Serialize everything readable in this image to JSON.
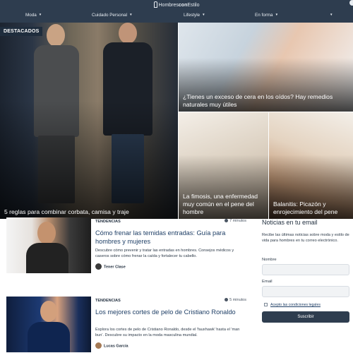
{
  "header": {
    "logo_part1": "Hombres",
    "logo_part2": "con",
    "logo_part3": "Estilo",
    "nav": [
      {
        "label": "Moda"
      },
      {
        "label": "Cuidado Personal"
      },
      {
        "label": "Lifestyle"
      },
      {
        "label": "En forma"
      },
      {
        "label": ""
      }
    ],
    "caret_icon": "caret-down-icon"
  },
  "hero": {
    "badge": "DESTACADOS",
    "tiles": [
      {
        "title": "5 reglas para combinar corbata, camisa y traje"
      },
      {
        "title": "¿Tienes un exceso de cera en los oídos? Hay remedios naturales muy útiles"
      },
      {
        "title": "La fimosis, una enfermedad muy común en el pene del hombre"
      },
      {
        "title": "Balanitis: Picazón y enrojecimiento del pene"
      }
    ]
  },
  "articles": [
    {
      "category": "TENDENCIAS",
      "read_time": "7 minutos",
      "title": "Cómo frenar las temidas entradas: Guía para hombres y mujeres",
      "description": "Descubre cómo prevenir y tratar las entradas en hombres. Consejos médicos y caseros sobre cómo frenar la caída y fortalecer tu cabello.",
      "author": "Tener Clase"
    },
    {
      "category": "TENDENCIAS",
      "read_time": "5 minutos",
      "title": "Los mejores cortes de pelo de Cristiano Ronaldo",
      "description": "Explora los cortes de pelo de Cristiano Ronaldo, desde el 'fauxhawk' hasta el 'man bun'. Descubre su impacto en la moda masculina mundial.",
      "author": "Lucas García"
    }
  ],
  "newsletter": {
    "title": "Noticias en tu email",
    "description": "Recibe las últimas noticias sobre moda y estilo de vida para hombres en tu correo electrónico.",
    "name_label": "Nombre",
    "name_value": "",
    "email_label": "Email",
    "email_value": "",
    "terms_label": "Acepto las condiciones legales",
    "subscribe_label": "Suscribir"
  },
  "colors": {
    "header_bg": "#2e3d4f",
    "title_link": "#1f3f66"
  }
}
